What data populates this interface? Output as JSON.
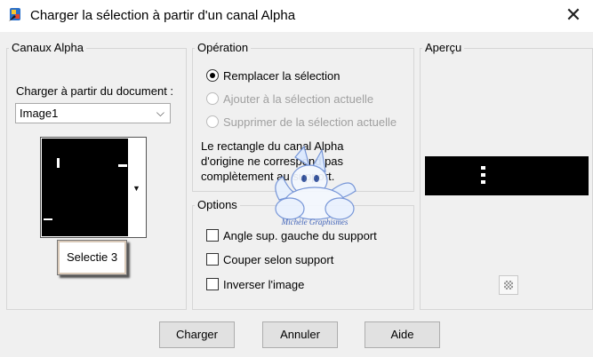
{
  "window": {
    "title": "Charger la sélection à partir d'un canal Alpha"
  },
  "canaux": {
    "legend": "Canaux Alpha",
    "doc_label": "Charger à partir du document :",
    "doc_value": "Image1",
    "thumb_tooltip": "Selectie 3"
  },
  "operation": {
    "legend": "Opération",
    "options": [
      {
        "label": "Remplacer la sélection",
        "selected": true,
        "enabled": true
      },
      {
        "label": "Ajouter à la sélection actuelle",
        "selected": false,
        "enabled": false
      },
      {
        "label": "Supprimer de la sélection actuelle",
        "selected": false,
        "enabled": false
      }
    ],
    "note_line1": "Le rectangle du canal Alpha",
    "note_line2": "d'origine ne correspond pas",
    "note_line3": "complètement au support."
  },
  "options": {
    "legend": "Options",
    "checks": [
      {
        "label": "Angle sup. gauche du support",
        "checked": false
      },
      {
        "label": "Couper selon support",
        "checked": false
      },
      {
        "label": "Inverser l'image",
        "checked": false
      }
    ]
  },
  "apercu": {
    "legend": "Aperçu"
  },
  "buttons": {
    "load": "Charger",
    "cancel": "Annuler",
    "help": "Aide"
  },
  "watermark": "Michèle Graphismes",
  "colors": {
    "title_bg": "#ffffff",
    "dialog_bg": "#f0f0f0",
    "preview_bg": "#000000"
  }
}
